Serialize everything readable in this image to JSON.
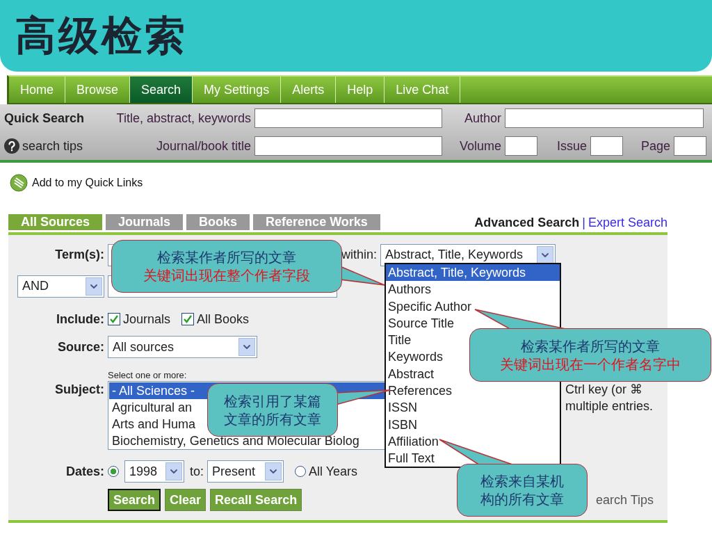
{
  "slide_title": "高级检索",
  "nav": [
    {
      "label": "Home",
      "selected": false
    },
    {
      "label": "Browse",
      "selected": false
    },
    {
      "label": "Search",
      "selected": true
    },
    {
      "label": "My Settings",
      "selected": false
    },
    {
      "label": "Alerts",
      "selected": false
    },
    {
      "label": "Help",
      "selected": false
    },
    {
      "label": "Live Chat",
      "selected": false
    }
  ],
  "quick_search": {
    "title": "Quick Search",
    "help": "search tips",
    "row1": [
      {
        "label": "Title, abstract, keywords"
      },
      {
        "label": "Author"
      }
    ],
    "row2": [
      {
        "label": "Journal/book title"
      },
      {
        "label": "Volume"
      },
      {
        "label": "Issue"
      },
      {
        "label": "Page"
      }
    ]
  },
  "quick_links": "Add to my Quick Links",
  "source_tabs": [
    {
      "label": "All Sources",
      "selected": true
    },
    {
      "label": "Journals",
      "selected": false
    },
    {
      "label": "Books",
      "selected": false
    },
    {
      "label": "Reference Works",
      "selected": false
    }
  ],
  "search_modes": {
    "current": "Advanced Search",
    "separator": "|",
    "link": "Expert Search"
  },
  "form": {
    "term_label": "Term(s):",
    "within_label": "within:",
    "within_value": "Abstract, Title, Keywords",
    "connector": "AND",
    "include_label": "Include:",
    "include": [
      {
        "label": "Journals",
        "checked": true
      },
      {
        "label": "All Books",
        "checked": true
      }
    ],
    "source_label": "Source:",
    "source_value": "All sources",
    "subject_hint": "Select one or more:",
    "subject_label": "Subject:",
    "subjects": [
      {
        "label": "- All Sciences -",
        "selected": true
      },
      {
        "label": "Agricultural an",
        "selected": false
      },
      {
        "label": "Arts and Huma",
        "selected": false
      },
      {
        "label": "Biochemistry, Genetics and Molecular Biolog",
        "selected": false
      }
    ],
    "subject_note": [
      "Ctrl key (or ⌘",
      "multiple entries."
    ],
    "dates_label": "Dates:",
    "from_selected": true,
    "from": "1998",
    "to_label": "to:",
    "to": "Present",
    "all_years": {
      "label": "All Years",
      "selected": false
    },
    "buttons": [
      {
        "label": "Search",
        "default": true
      },
      {
        "label": "Clear",
        "default": false
      },
      {
        "label": "Recall Search",
        "default": false
      }
    ],
    "search_tips": "earch Tips"
  },
  "within_dropdown": [
    {
      "label": "Abstract, Title, Keywords",
      "selected": true
    },
    {
      "label": "Authors",
      "selected": false
    },
    {
      "label": "Specific Author",
      "selected": false
    },
    {
      "label": "Source Title",
      "selected": false
    },
    {
      "label": "Title",
      "selected": false
    },
    {
      "label": "Keywords",
      "selected": false
    },
    {
      "label": "Abstract",
      "selected": false
    },
    {
      "label": "References",
      "selected": false
    },
    {
      "label": "ISSN",
      "selected": false
    },
    {
      "label": "ISBN",
      "selected": false
    },
    {
      "label": "Affiliation",
      "selected": false
    },
    {
      "label": "Full Text",
      "selected": false
    }
  ],
  "callouts": [
    {
      "lines": [
        {
          "text": "检索某作者所写的文章",
          "color": "#1f3a6e"
        },
        {
          "text": "关键词出现在整个作者字段",
          "color": "#e0141e"
        }
      ]
    },
    {
      "lines": [
        {
          "text": "检索某作者所写的文章",
          "color": "#1f3a6e"
        },
        {
          "text": "关键词出现在一个作者名字中",
          "color": "#e0141e"
        }
      ]
    },
    {
      "lines": [
        {
          "text": "检索引用了某篇",
          "color": "#1f3a6e"
        },
        {
          "text": "文章的所有文章",
          "color": "#1f3a6e"
        }
      ]
    },
    {
      "lines": [
        {
          "text": "检索来自某机",
          "color": "#1f3a6e"
        },
        {
          "text": "构的所有文章",
          "color": "#1f3a6e"
        }
      ]
    }
  ]
}
